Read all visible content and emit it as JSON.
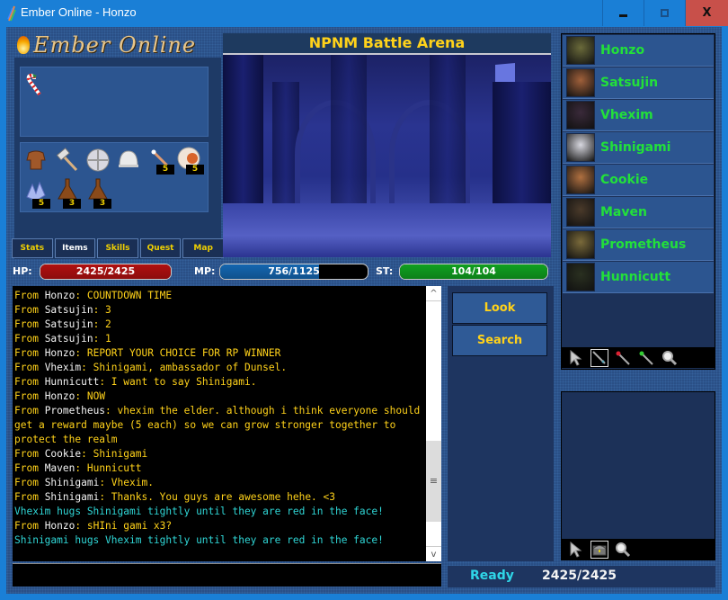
{
  "window": {
    "title": "Ember Online - Honzo",
    "minimize": "–",
    "maximize": "□",
    "close": "X"
  },
  "logo": {
    "text": "Ember Online"
  },
  "equipment": [
    {
      "name": "candy-cane",
      "icon": "candy-cane-icon"
    }
  ],
  "inventory": [
    {
      "name": "leather-armor",
      "icon": "leather-armor-icon",
      "qty": null
    },
    {
      "name": "hammer",
      "icon": "hammer-icon",
      "qty": null
    },
    {
      "name": "round-shield",
      "icon": "round-shield-icon",
      "qty": null
    },
    {
      "name": "helmet",
      "icon": "helmet-icon",
      "qty": null
    },
    {
      "name": "wand",
      "icon": "wand-icon",
      "qty": "5"
    },
    {
      "name": "meat",
      "icon": "meat-icon",
      "qty": "5"
    },
    {
      "name": "crystal",
      "icon": "crystal-icon",
      "qty": "5"
    },
    {
      "name": "potion-flask",
      "icon": "flask-icon",
      "qty": "3"
    },
    {
      "name": "potion-flask-2",
      "icon": "flask-icon",
      "qty": "3"
    }
  ],
  "tabs": [
    {
      "label": "Stats",
      "active": false
    },
    {
      "label": "Items",
      "active": true
    },
    {
      "label": "Skills",
      "active": false
    },
    {
      "label": "Quest",
      "active": false
    },
    {
      "label": "Map",
      "active": false
    }
  ],
  "scene": {
    "title": "NPNM Battle Arena"
  },
  "stats": {
    "hp": {
      "label": "HP:",
      "text": "2425/2425",
      "current": 2425,
      "max": 2425,
      "color": "#b01010"
    },
    "mp": {
      "label": "MP:",
      "text": "756/1125",
      "current": 756,
      "max": 1125,
      "color": "#1466b0"
    },
    "st": {
      "label": "ST:",
      "text": "104/104",
      "current": 104,
      "max": 104,
      "color": "#10a020"
    }
  },
  "chat": [
    {
      "type": "say",
      "from": "From ",
      "who": "Honzo",
      "msg": ": COUNTDOWN TIME"
    },
    {
      "type": "say",
      "from": "From ",
      "who": "Satsujin",
      "msg": ": 3"
    },
    {
      "type": "say",
      "from": "From ",
      "who": "Satsujin",
      "msg": ": 2"
    },
    {
      "type": "say",
      "from": "From ",
      "who": "Satsujin",
      "msg": ": 1"
    },
    {
      "type": "say",
      "from": "From ",
      "who": "Honzo",
      "msg": ": REPORT YOUR CHOICE FOR RP WINNER"
    },
    {
      "type": "say",
      "from": "From ",
      "who": "Vhexim",
      "msg": ": Shinigami, ambassador of Dunsel."
    },
    {
      "type": "say",
      "from": "From ",
      "who": "Hunnicutt",
      "msg": ": I want to say Shinigami."
    },
    {
      "type": "say",
      "from": "From ",
      "who": "Honzo",
      "msg": ": NOW"
    },
    {
      "type": "say",
      "from": "From ",
      "who": "Prometheus",
      "msg": ": vhexim the elder. although i think everyone should get a reward maybe (5 each) so we can grow stronger together to protect the realm"
    },
    {
      "type": "say",
      "from": "From ",
      "who": "Cookie",
      "msg": ": Shinigami"
    },
    {
      "type": "say",
      "from": "From ",
      "who": "Maven",
      "msg": ": Hunnicutt"
    },
    {
      "type": "say",
      "from": "From ",
      "who": "Shinigami",
      "msg": ": Vhexim."
    },
    {
      "type": "say",
      "from": "From ",
      "who": "Shinigami",
      "msg": ": Thanks. You guys are awesome hehe. <3"
    },
    {
      "type": "emote",
      "text": "Vhexim hugs Shinigami tightly until they are red in the face!"
    },
    {
      "type": "say",
      "from": "From ",
      "who": "Honzo",
      "msg": ": sHIni gami x3?"
    },
    {
      "type": "emote",
      "text": "Shinigami hugs Vhexim tightly until they are red in the face!"
    }
  ],
  "chat_input": {
    "value": ""
  },
  "actions": [
    {
      "label": "Look"
    },
    {
      "label": "Search"
    }
  ],
  "players": [
    {
      "name": "Honzo",
      "portrait": "#6a6a3a"
    },
    {
      "name": "Satsujin",
      "portrait": "#a0603a"
    },
    {
      "name": "Vhexim",
      "portrait": "#3a2a3a"
    },
    {
      "name": "Shinigami",
      "portrait": "#d8d8e0"
    },
    {
      "name": "Cookie",
      "portrait": "#b07040"
    },
    {
      "name": "Maven",
      "portrait": "#4a3a2a"
    },
    {
      "name": "Prometheus",
      "portrait": "#7a6a3a"
    },
    {
      "name": "Hunnicutt",
      "portrait": "#2a3020"
    }
  ],
  "player_tools": [
    {
      "icon": "pointer-icon",
      "selected": false
    },
    {
      "icon": "sword-icon",
      "selected": true
    },
    {
      "icon": "red-wand-icon",
      "selected": false
    },
    {
      "icon": "green-wand-icon",
      "selected": false
    },
    {
      "icon": "magnifier-icon",
      "selected": false
    }
  ],
  "ground_tools": [
    {
      "icon": "pointer-icon",
      "selected": false
    },
    {
      "icon": "chest-icon",
      "selected": true
    },
    {
      "icon": "magnifier-icon",
      "selected": false
    }
  ],
  "status": {
    "text": "Ready",
    "hp": "2425/2425"
  }
}
